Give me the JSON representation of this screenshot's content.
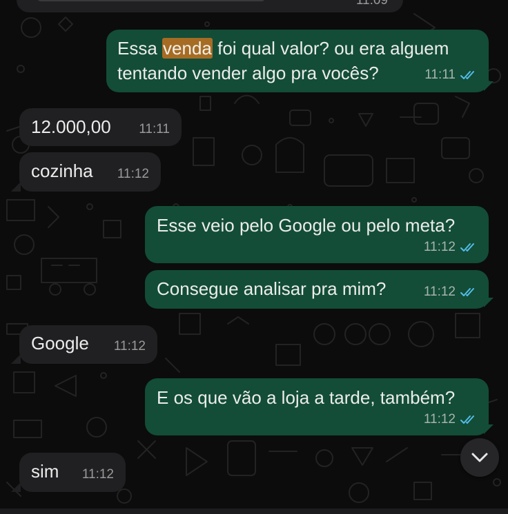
{
  "colors": {
    "background": "#0c0c0c",
    "incoming_bubble": "#202022",
    "outgoing_bubble": "#134d37",
    "text": "#ececec",
    "read_ticks": "#53bdeb",
    "highlight": "#a66c24"
  },
  "top_message": {
    "time": "11:09"
  },
  "messages": [
    {
      "direction": "outgoing",
      "text_before": "Essa ",
      "highlight": "venda",
      "text_after": " foi qual valor? ou era alguem",
      "line2": "tentando vender algo pra vocês?",
      "time": "11:11",
      "status": "read"
    },
    {
      "direction": "incoming",
      "text": "12.000,00",
      "time": "11:11"
    },
    {
      "direction": "incoming",
      "text": "cozinha",
      "time": "11:12"
    },
    {
      "direction": "outgoing",
      "text": "Esse veio pelo Google ou pelo meta?",
      "time": "11:12",
      "status": "read"
    },
    {
      "direction": "outgoing",
      "text": "Consegue analisar pra mim?",
      "time": "11:12",
      "status": "read"
    },
    {
      "direction": "incoming",
      "text": "Google",
      "time": "11:12"
    },
    {
      "direction": "outgoing",
      "text": "E os que vão a loja a tarde, também?",
      "time": "11:12",
      "status": "read"
    },
    {
      "direction": "incoming",
      "text": "sim",
      "time": "11:12"
    }
  ],
  "scroll_button": {
    "icon": "chevron-down-icon"
  },
  "icons": {
    "read_receipt": "double-check-icon",
    "scroll_down": "chevron-down-icon"
  }
}
